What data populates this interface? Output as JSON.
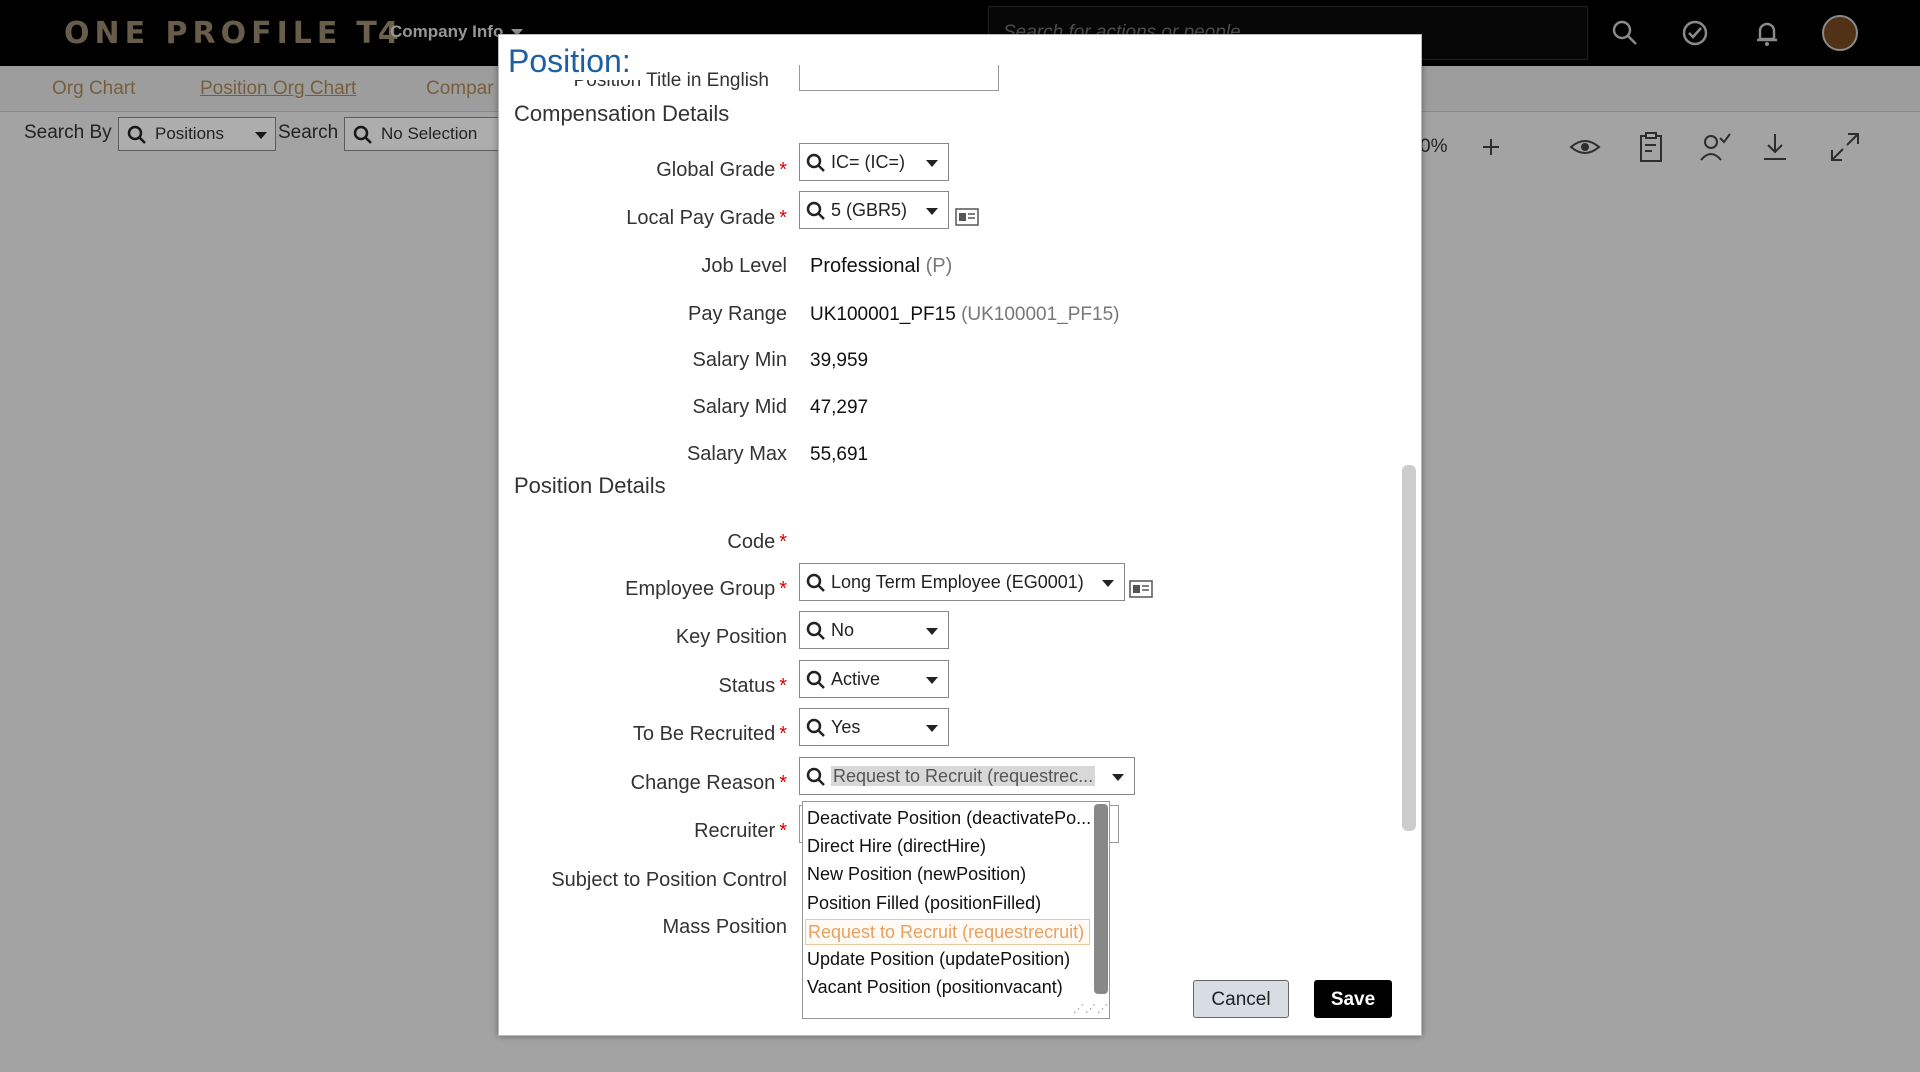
{
  "app": {
    "logo_text": "ONE PROFILE",
    "logo_suffix": "T4",
    "company_menu": "Company Info"
  },
  "top_search": {
    "placeholder": "Search for actions or people"
  },
  "subnav": {
    "org_chart": "Org Chart",
    "position_org_chart": "Position Org Chart",
    "company": "Compar"
  },
  "searchbar": {
    "search_by_label": "Search By",
    "search_by_value": "Positions",
    "search_label": "Search",
    "search_value": "No Selection",
    "zoom_text": "0%"
  },
  "dialog": {
    "title": "Position:",
    "cut_field_label": "Position Title in English",
    "compensation": {
      "title": "Compensation Details",
      "global_grade": {
        "label": "Global Grade",
        "value": "IC= (IC=)"
      },
      "local_pay_grade": {
        "label": "Local Pay Grade",
        "value": "5 (GBR5)"
      },
      "job_level": {
        "label": "Job Level",
        "value": "Professional",
        "code": "(P)"
      },
      "pay_range": {
        "label": "Pay Range",
        "value": "UK100001_PF15",
        "code": "(UK100001_PF15)"
      },
      "salary_min": {
        "label": "Salary Min",
        "value": "39,959"
      },
      "salary_mid": {
        "label": "Salary Mid",
        "value": "47,297"
      },
      "salary_max": {
        "label": "Salary Max",
        "value": "55,691"
      }
    },
    "position": {
      "title": "Position Details",
      "code": {
        "label": "Code"
      },
      "employee_group": {
        "label": "Employee Group",
        "value": "Long Term Employee (EG0001)"
      },
      "key_position": {
        "label": "Key Position",
        "value": "No"
      },
      "status": {
        "label": "Status",
        "value": "Active"
      },
      "to_be_recruited": {
        "label": "To Be Recruited",
        "value": "Yes"
      },
      "change_reason": {
        "label": "Change Reason",
        "value": "Request to Recruit (requestrec..."
      },
      "recruiter": {
        "label": "Recruiter"
      },
      "subject_to_position_control": {
        "label": "Subject to Position Control"
      },
      "mass_position": {
        "label": "Mass Position"
      }
    },
    "change_reason_options": [
      "Deactivate Position (deactivatePo...",
      "Direct Hire (directHire)",
      "New Position (newPosition)",
      "Position Filled (positionFilled)",
      "Request to Recruit (requestrecruit)",
      "Update Position (updatePosition)",
      "Vacant Position (positionvacant)"
    ],
    "required_mark": "*",
    "buttons": {
      "cancel": "Cancel",
      "save": "Save"
    }
  },
  "colors": {
    "accent": "#1d5fa0",
    "nav_link": "#b08c5a",
    "required": "#dd0000",
    "highlight_option": "#e8a060"
  }
}
